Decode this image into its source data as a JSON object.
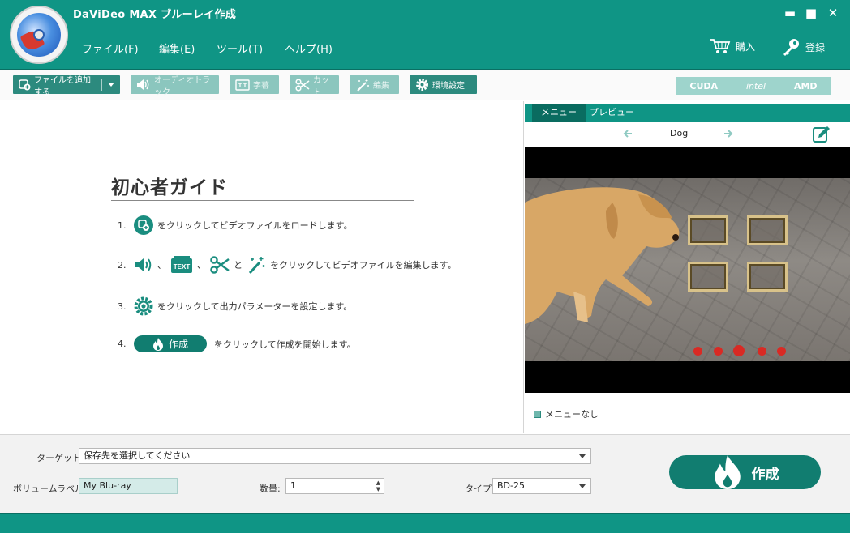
{
  "app": {
    "title": "DaViDeo MAX ブルーレイ作成"
  },
  "window_controls": {
    "minimize": "▬",
    "maximize": "■",
    "close": "✕"
  },
  "menu": [
    "ファイル(F)",
    "編集(E)",
    "ツール(T)",
    "ヘルプ(H)"
  ],
  "header_actions": {
    "buy": "購入",
    "register": "登録"
  },
  "toolbar": {
    "add_file": "ファイルを追加する",
    "audio_track": "オーディオトラック",
    "subtitle": "字幕",
    "cut": "カット",
    "edit": "編集",
    "settings": "環境設定"
  },
  "badges": {
    "cuda": "CUDA",
    "intel": "intel",
    "amd": "AMD"
  },
  "guide": {
    "title": "初心者ガイド",
    "steps": [
      {
        "num": "1.",
        "text": "をクリックしてビデオファイルをロードします。"
      },
      {
        "num": "2.",
        "text": "をクリックしてビデオファイルを編集します。",
        "sep1": "、",
        "sep2": "、",
        "and": "と",
        "text_badge": "TEXT"
      },
      {
        "num": "3.",
        "text": "をクリックして出力パラメーターを設定します。"
      },
      {
        "num": "4.",
        "text": "をクリックして作成を開始します。",
        "button": "作成"
      }
    ]
  },
  "preview": {
    "tabs": [
      "メニュー",
      "プレビュー"
    ],
    "active_tab": 0,
    "menu_title": "Dog",
    "menu_none_label": "メニューなし"
  },
  "bottom": {
    "target_label": "ターゲット:",
    "target_placeholder": "保存先を選択してください",
    "volume_label": "ボリュームラベル:",
    "volume_value": "My Blu-ray",
    "count_label": "数量:",
    "count_value": "1",
    "type_label": "タイプ:",
    "type_value": "BD-25",
    "create_button": "作成"
  },
  "colors": {
    "brand": "#0f9585",
    "accent_dark": "#117d70",
    "toolbar_button": "#2c8a7e"
  }
}
